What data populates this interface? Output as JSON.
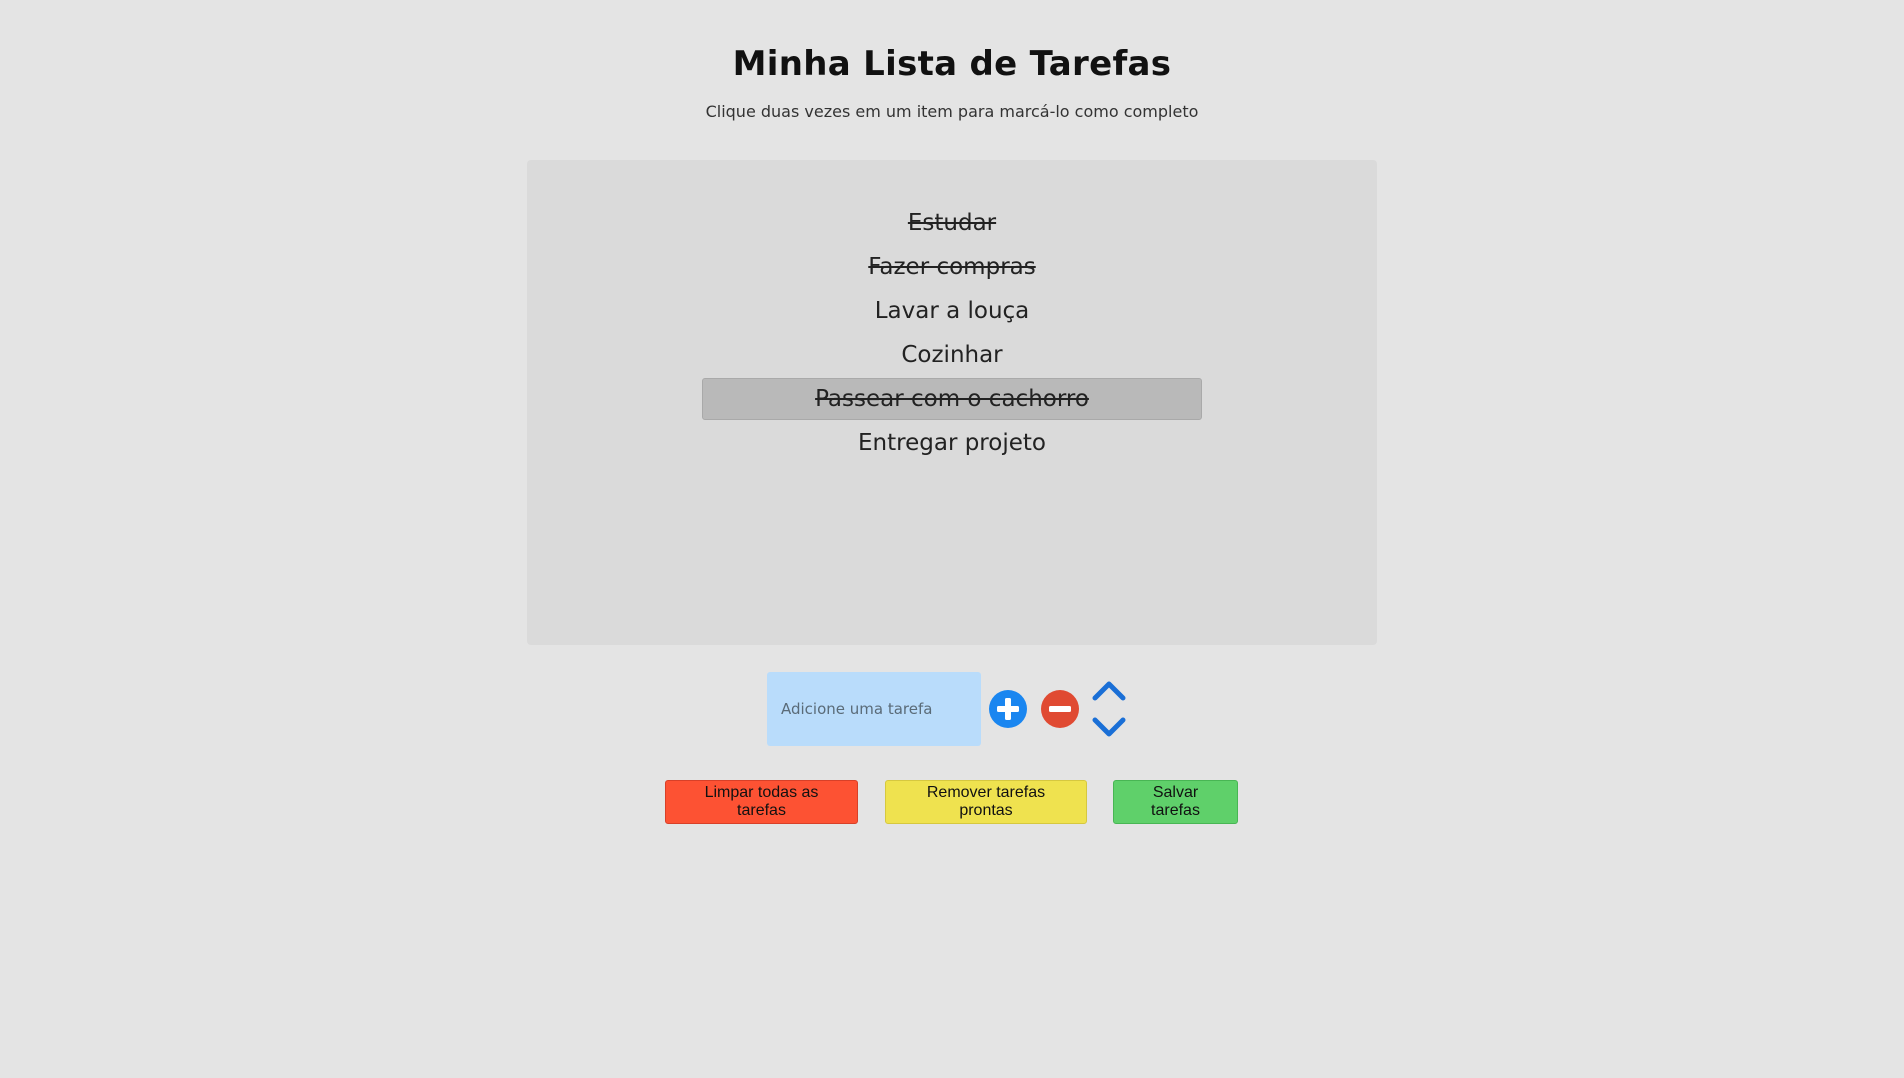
{
  "header": {
    "title": "Minha Lista de Tarefas",
    "subtitle": "Clique duas vezes em um item para marcá-lo como completo"
  },
  "tasks": [
    {
      "text": "Estudar",
      "done": true,
      "selected": false
    },
    {
      "text": "Fazer compras",
      "done": true,
      "selected": false
    },
    {
      "text": "Lavar a louça",
      "done": false,
      "selected": false
    },
    {
      "text": "Cozinhar",
      "done": false,
      "selected": false
    },
    {
      "text": "Passear com o cachorro",
      "done": true,
      "selected": true
    },
    {
      "text": "Entregar projeto",
      "done": false,
      "selected": false
    }
  ],
  "input": {
    "placeholder": "Adicione uma tarefa",
    "value": ""
  },
  "controls": {
    "add_icon": "plus-circle-icon",
    "remove_icon": "minus-circle-icon",
    "up_icon": "chevron-up-icon",
    "down_icon": "chevron-down-icon"
  },
  "actions": {
    "clear_all": "Limpar todas as tarefas",
    "remove_done": "Remover tarefas prontas",
    "save": "Salvar tarefas"
  },
  "colors": {
    "background": "#e4e4e4",
    "panel": "#dadada",
    "selected_row": "#b9b9b9",
    "input_bg": "#b9dcfb",
    "add_blue": "#1a86f0",
    "remove_red": "#e04a32",
    "arrow_blue": "#1a6fd6",
    "clear_btn": "#fd5233",
    "remove_done_btn": "#efe24f",
    "save_btn": "#5fd06a"
  }
}
